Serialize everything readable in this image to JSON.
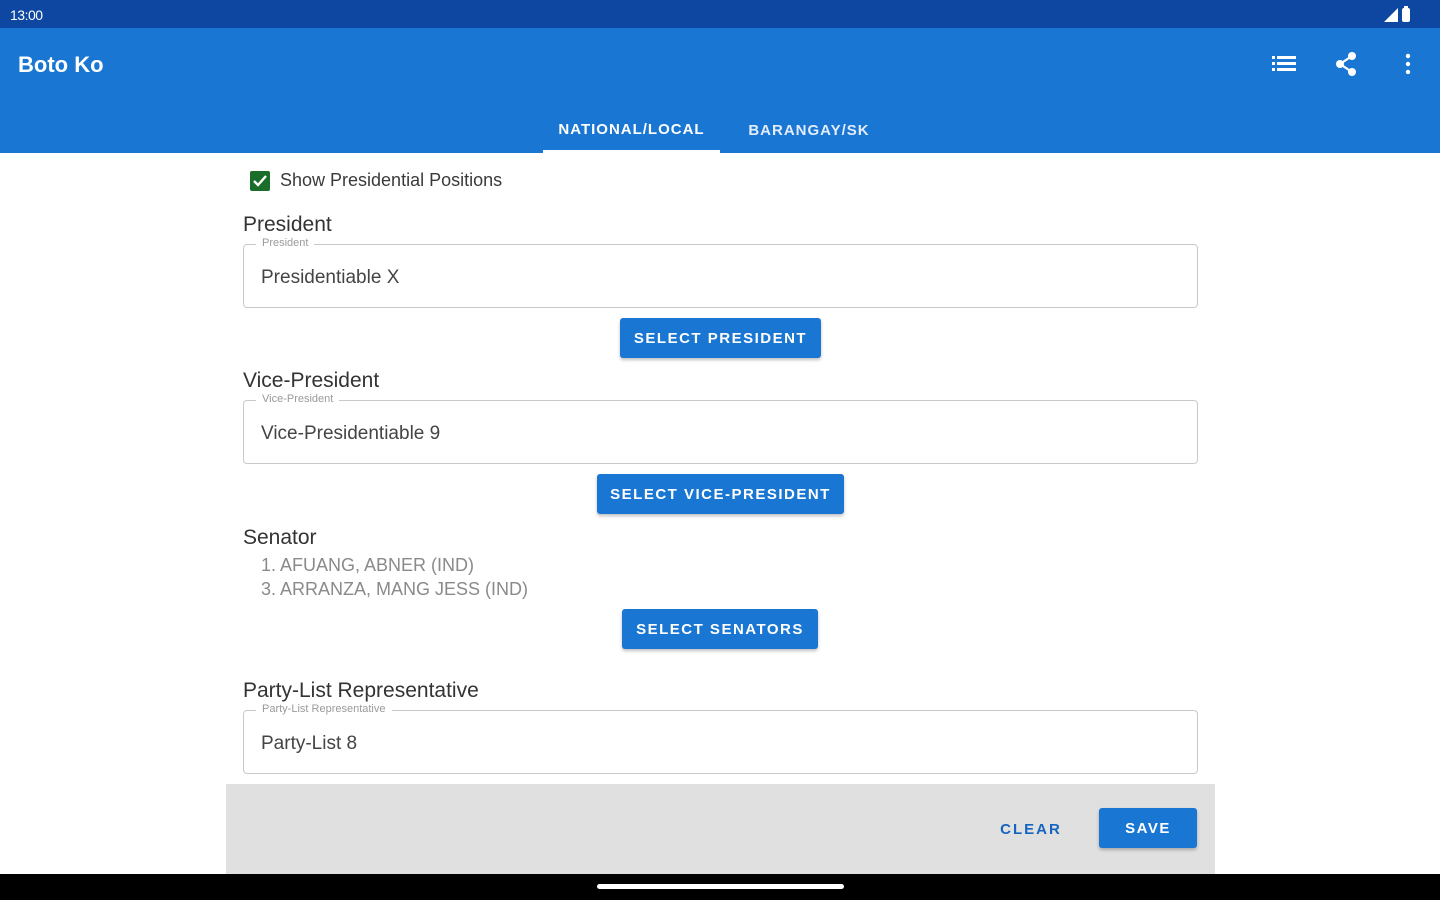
{
  "status_bar": {
    "time": "13:00"
  },
  "app_bar": {
    "title": "Boto Ko",
    "actions": [
      "list-icon",
      "share-icon",
      "more-vert-icon"
    ]
  },
  "tabs": [
    {
      "label": "NATIONAL/LOCAL",
      "active": true
    },
    {
      "label": "BARANGAY/SK",
      "active": false
    }
  ],
  "show_presidential": {
    "label": "Show Presidential Positions",
    "checked": true
  },
  "president": {
    "title": "President",
    "field_label": "President",
    "value": "Presidentiable X",
    "button": "SELECT PRESIDENT"
  },
  "vice_president": {
    "title": "Vice-President",
    "field_label": "Vice-President",
    "value": "Vice-Presidentiable 9",
    "button": "SELECT VICE-PRESIDENT"
  },
  "senator": {
    "title": "Senator",
    "items": [
      "1. AFUANG, ABNER (IND)",
      "3. ARRANZA, MANG JESS (IND)"
    ],
    "button": "SELECT SENATORS"
  },
  "party_list": {
    "title": "Party-List Representative",
    "field_label": "Party-List Representative",
    "value": "Party-List 8"
  },
  "footer": {
    "clear": "CLEAR",
    "save": "SAVE"
  },
  "colors": {
    "primary": "#1976d2",
    "status_bar": "#0d47a1",
    "checkbox": "#1b6e2a",
    "panel": "#e0e0e0"
  }
}
